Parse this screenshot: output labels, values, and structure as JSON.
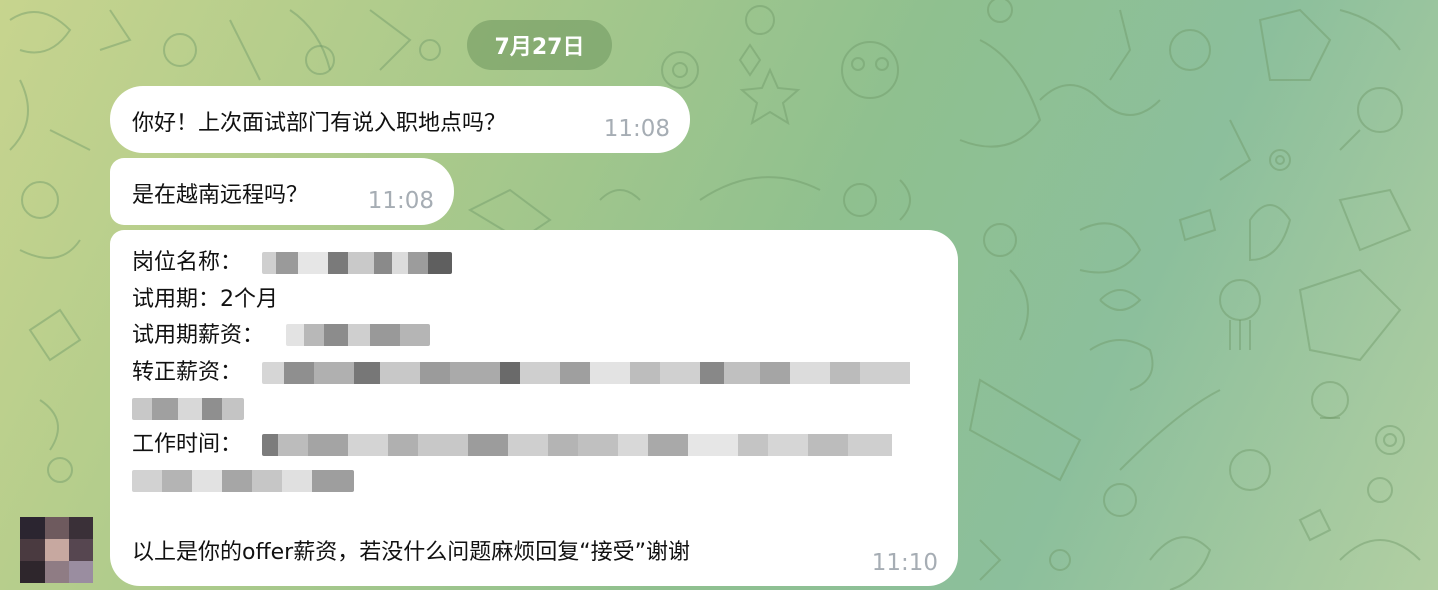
{
  "chat": {
    "date_label": "7月27日",
    "messages": [
      {
        "text": "你好！上次面试部门有说入职地点吗？",
        "time": "11:08"
      },
      {
        "text": "是在越南远程吗？",
        "time": "11:08"
      }
    ],
    "offer": {
      "position_label": "岗位名称：",
      "probation_label": "试用期：",
      "probation_value": "2个月",
      "probation_salary_label": "试用期薪资：",
      "regular_salary_label": "转正薪资：",
      "work_hours_label": "工作时间：",
      "closing_text": "以上是你的offer薪资，若没什么问题麻烦回复“接受”谢谢",
      "time": "11:10"
    }
  },
  "colors": {
    "bubble": "#ffffff",
    "timestamp": "#a6adb4",
    "date_pill": "#6e965f"
  },
  "icons": [
    "avatar"
  ]
}
